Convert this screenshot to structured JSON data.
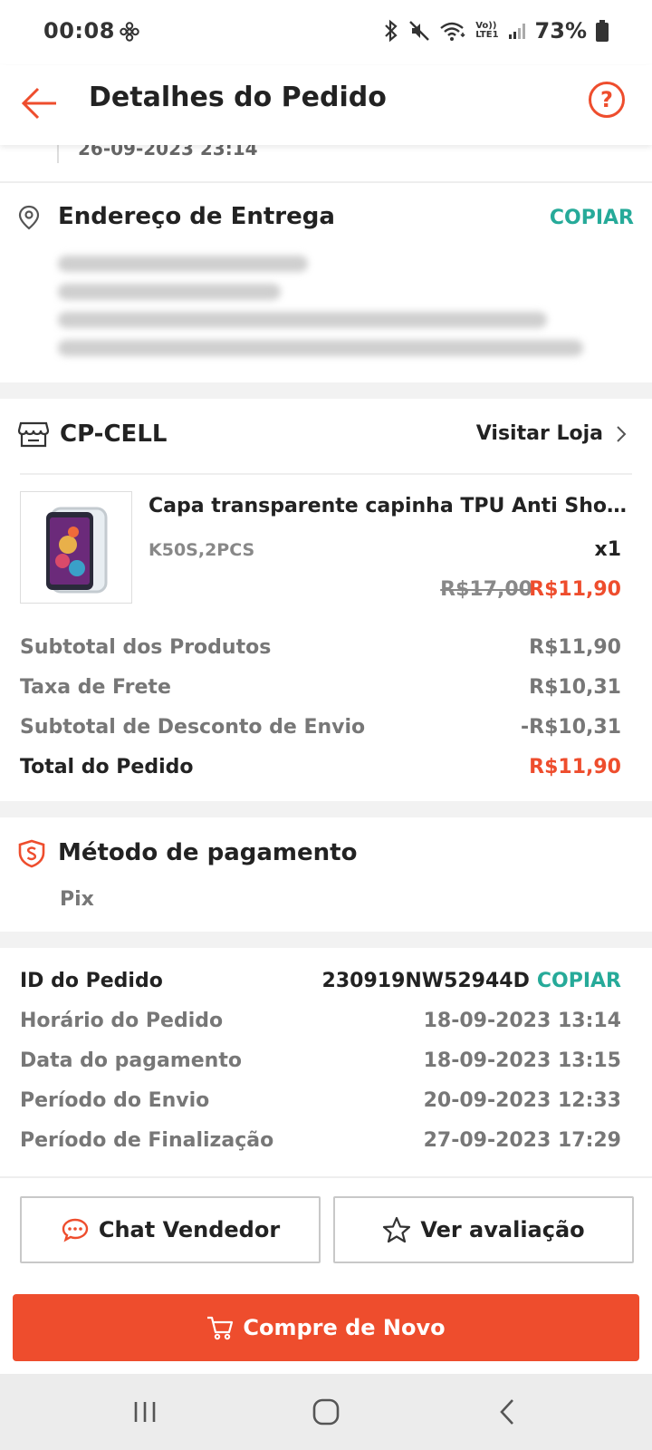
{
  "status_bar": {
    "time": "00:08",
    "battery": "73%",
    "network_label_top": "Vo))",
    "network_label_bottom": "LTE1"
  },
  "header": {
    "title": "Detalhes do Pedido"
  },
  "previous_timestamp": "26-09-2023 23:14",
  "address": {
    "title": "Endereço de Entrega",
    "copy_label": "COPIAR"
  },
  "shop": {
    "name": "CP-CELL",
    "visit_label": "Visitar Loja"
  },
  "product": {
    "name": "Capa transparente capinha TPU Anti Shock I...",
    "variant": "K50S,2PCS",
    "quantity": "x1",
    "original_price": "R$17,00",
    "price": "R$11,90"
  },
  "summary": [
    {
      "label": "Subtotal dos Produtos",
      "value": "R$11,90"
    },
    {
      "label": "Taxa de Frete",
      "value": "R$10,31"
    },
    {
      "label": "Subtotal de Desconto de Envio",
      "value": "-R$10,31"
    },
    {
      "label": "Total do Pedido",
      "value": "R$11,90"
    }
  ],
  "payment": {
    "title": "Método de pagamento",
    "method": "Pix"
  },
  "order_info": {
    "id_label": "ID do Pedido",
    "id_value": "230919NW52944D",
    "copy_label": "COPIAR",
    "rows": [
      {
        "label": "Horário do Pedido",
        "value": "18-09-2023 13:14"
      },
      {
        "label": "Data do pagamento",
        "value": "18-09-2023 13:15"
      },
      {
        "label": "Período do Envio",
        "value": "20-09-2023 12:33"
      },
      {
        "label": "Período de Finalização",
        "value": "27-09-2023 17:29"
      }
    ]
  },
  "buttons": {
    "chat": "Chat Vendedor",
    "review": "Ver avaliação",
    "buy_again": "Compre de Novo"
  },
  "colors": {
    "accent": "#ee4d2d",
    "copy": "#26aa99"
  }
}
